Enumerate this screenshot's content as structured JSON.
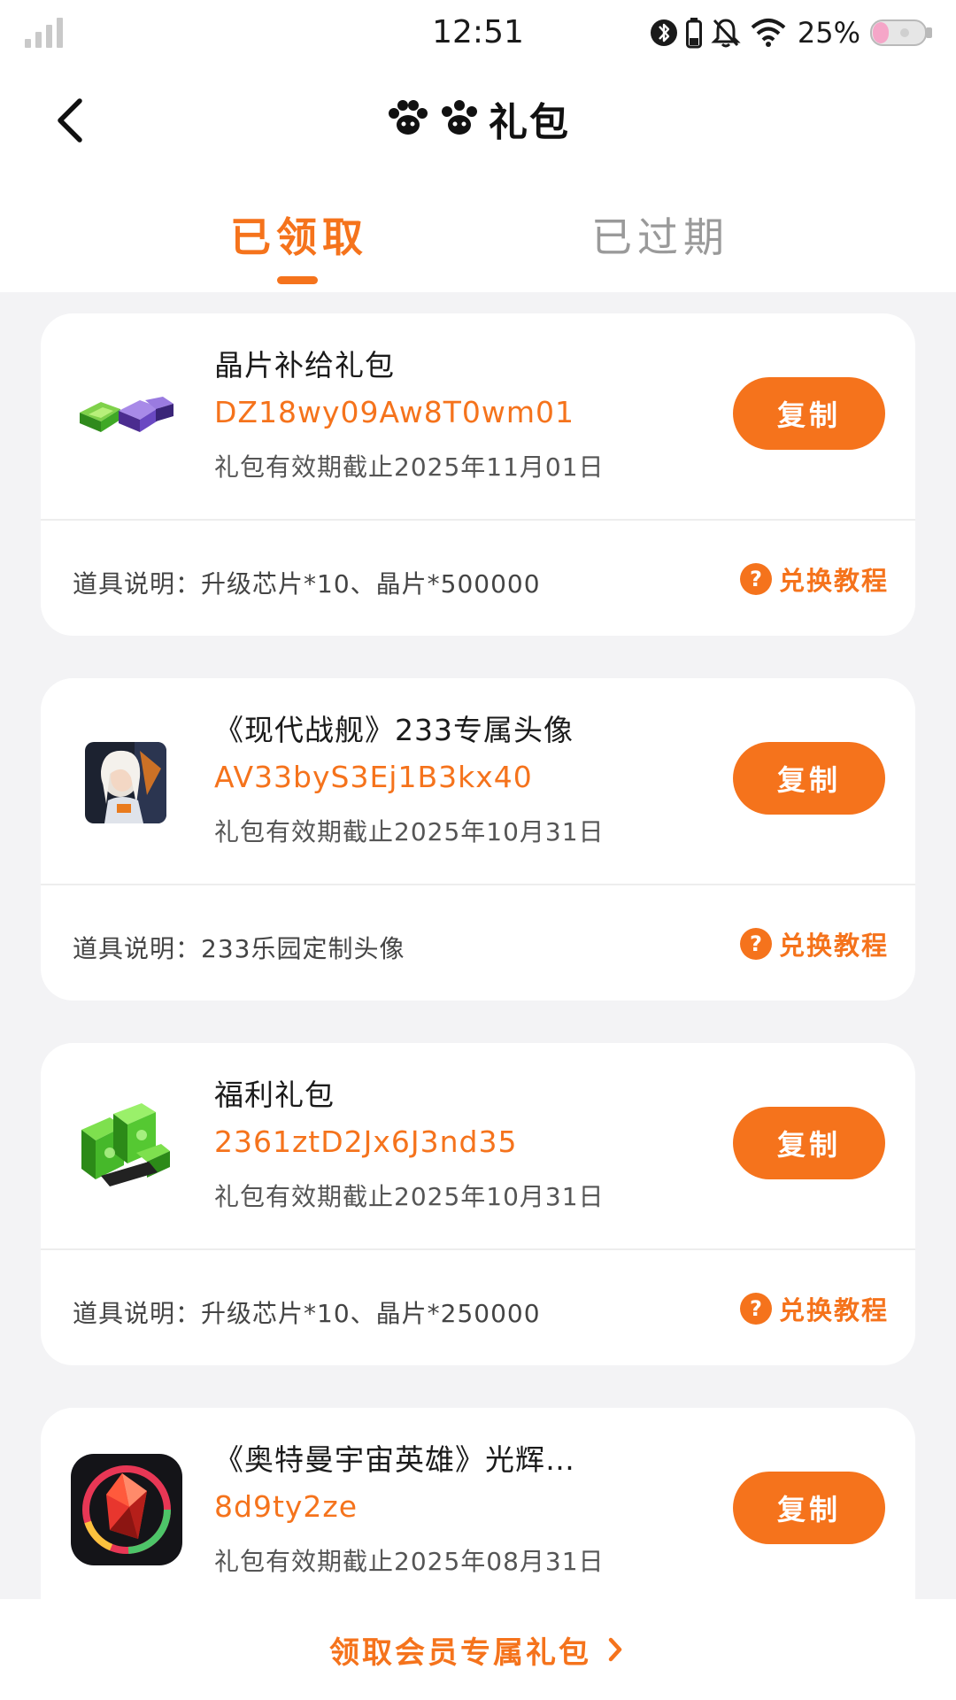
{
  "status_bar": {
    "time": "12:51",
    "battery_percent": "25%",
    "icons": [
      "signal-icon",
      "bluetooth-icon",
      "battery-small-icon",
      "mute-bell-icon",
      "wifi-icon",
      "cat-battery-icon"
    ]
  },
  "nav": {
    "title": "礼包",
    "logo_icon": "paw-logo-icon",
    "back_icon": "back-arrow-icon"
  },
  "tabs": [
    {
      "label": "已领取",
      "active": true
    },
    {
      "label": "已过期",
      "active": false
    }
  ],
  "gifts": [
    {
      "name": "晶片补给礼包",
      "code": "DZ18wy09Aw8T0wm01",
      "expiry": "礼包有效期截止2025年11月01日",
      "copy_label": "复制",
      "desc": "道具说明：升级芯片*10、晶片*500000",
      "tutorial_label": "兑换教程",
      "thumb_icon": "crystal-chips-icon"
    },
    {
      "name": "《现代战舰》233专属头像",
      "code": "AV33byS3Ej1B3kx40",
      "expiry": "礼包有效期截止2025年10月31日",
      "copy_label": "复制",
      "desc": "道具说明：233乐园定制头像",
      "tutorial_label": "兑换教程",
      "thumb_icon": "avatar-portrait-icon"
    },
    {
      "name": "福利礼包",
      "code": "2361ztD2Jx6J3nd35",
      "expiry": "礼包有效期截止2025年10月31日",
      "copy_label": "复制",
      "desc": "道具说明：升级芯片*10、晶片*250000",
      "tutorial_label": "兑换教程",
      "thumb_icon": "green-chips-icon"
    },
    {
      "name": "《奥特曼宇宙英雄》光辉…",
      "code": "8d9ty2ze",
      "expiry": "礼包有效期截止2025年08月31日",
      "copy_label": "复制",
      "thumb_icon": "glowing-crystal-icon"
    }
  ],
  "footer": {
    "member_link": "领取会员专属礼包"
  },
  "colors": {
    "accent": "#f5731c",
    "page_bg": "#f3f3f5",
    "card_bg": "#ffffff",
    "inactive_tab": "#9a9a9a"
  }
}
